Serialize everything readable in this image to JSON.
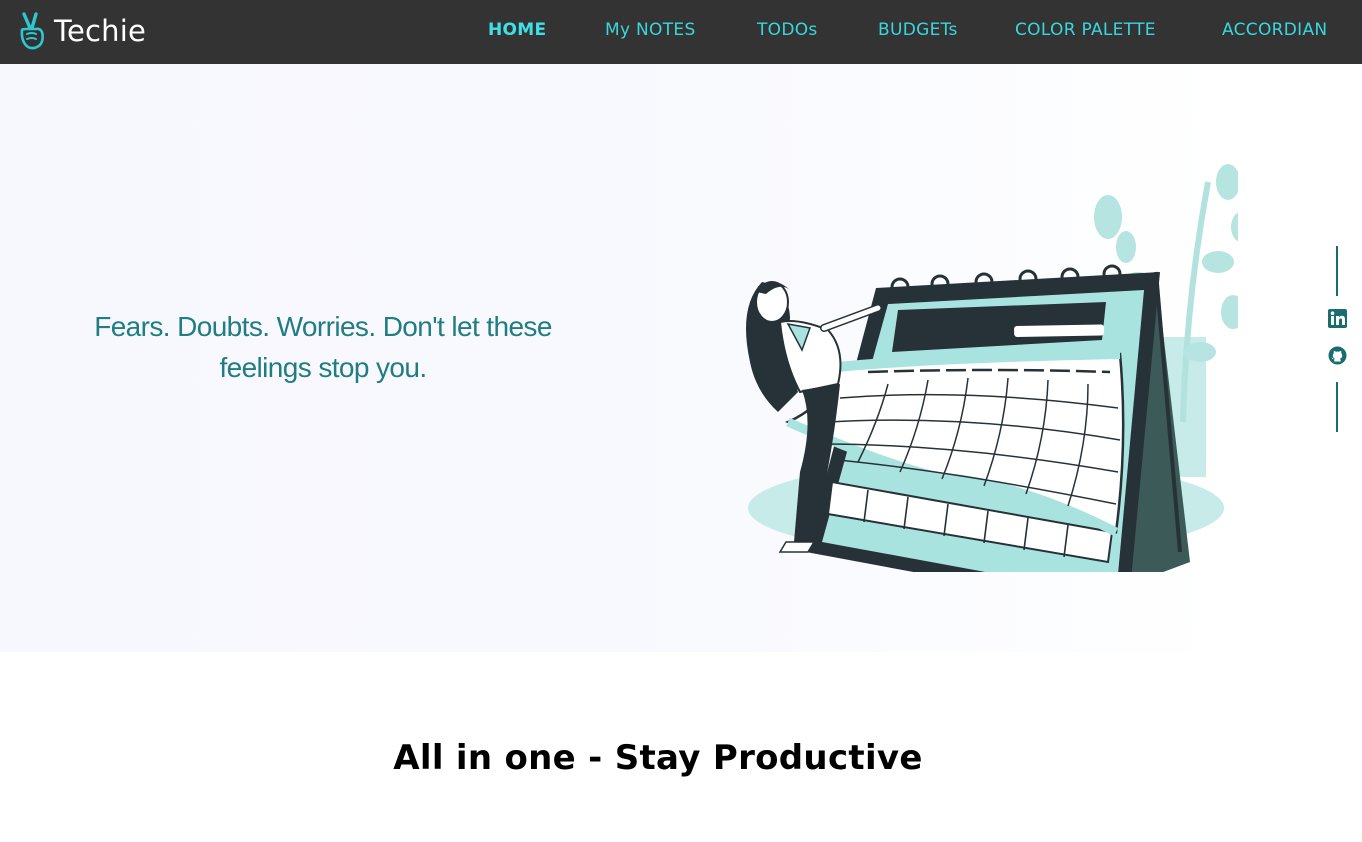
{
  "navbar": {
    "brand": {
      "name": "Techie",
      "icon": "peace-hand-icon"
    },
    "links": [
      {
        "label": "HOME",
        "active": true
      },
      {
        "label": "My NOTES",
        "active": false
      },
      {
        "label": "TODOs",
        "active": false
      },
      {
        "label": "BUDGETs",
        "active": false
      },
      {
        "label": "COLOR PALETTE",
        "active": false
      },
      {
        "label": "ACCORDIAN",
        "active": false
      }
    ]
  },
  "hero": {
    "quote": "Fears. Doubts. Worries. Don't let these feelings stop you.",
    "illustration": "woman-flipping-calendar-illustration"
  },
  "social": [
    {
      "icon": "linkedin-icon"
    },
    {
      "icon": "github-icon"
    }
  ],
  "section": {
    "heading": "All in one - Stay Productive"
  },
  "colors": {
    "navbar_bg": "#333333",
    "nav_link": "#39d7dd",
    "quote": "#1f7d83",
    "accent_teal": "#a9e3df",
    "social": "#1a6d6f"
  }
}
